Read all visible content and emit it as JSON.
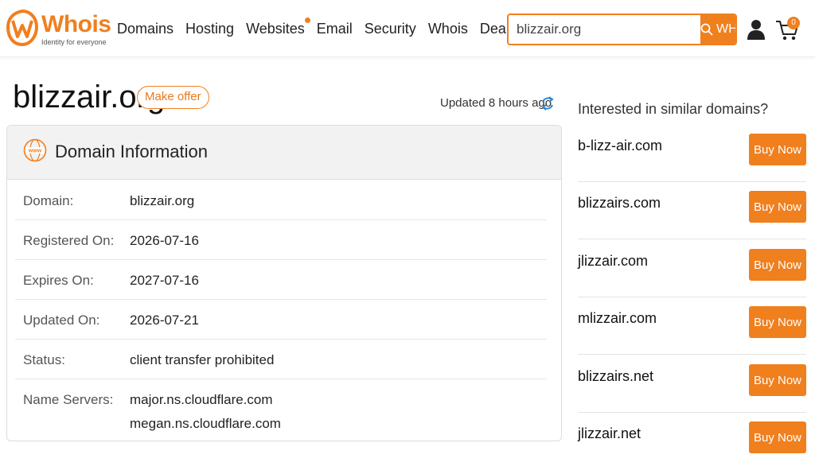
{
  "brand": {
    "name": "Whois",
    "tagline": "Identity for everyone",
    "accent_color": "#f07f1e"
  },
  "nav": {
    "items": [
      {
        "label": "Domains"
      },
      {
        "label": "Hosting"
      },
      {
        "label": "Websites",
        "has_dot": true
      },
      {
        "label": "Email"
      },
      {
        "label": "Security"
      },
      {
        "label": "Whois"
      },
      {
        "label": "Deals"
      }
    ]
  },
  "search": {
    "value": "blizzair.org",
    "button_label": "WHOIS"
  },
  "cart": {
    "count": "0"
  },
  "icons": {
    "logo": "whois-logo-icon",
    "search": "search-icon",
    "user": "user-icon",
    "cart": "cart-icon",
    "refresh": "refresh-icon",
    "www": "www-globe-icon"
  },
  "page": {
    "title": "blizzair.org",
    "make_offer_label": "Make offer",
    "updated_text": "Updated 8 hours ago"
  },
  "domain_info": {
    "title": "Domain Information",
    "rows": [
      {
        "label": "Domain:",
        "value": "blizzair.org"
      },
      {
        "label": "Registered On:",
        "value": "2026-07-16"
      },
      {
        "label": "Expires On:",
        "value": "2027-07-16"
      },
      {
        "label": "Updated On:",
        "value": "2026-07-21"
      },
      {
        "label": "Status:",
        "value": "client transfer prohibited"
      },
      {
        "label": "Name Servers:",
        "value": "major.ns.cloudflare.com",
        "value2": "megan.ns.cloudflare.com"
      }
    ]
  },
  "similar": {
    "title": "Interested in similar domains?",
    "buy_label": "Buy Now",
    "items": [
      {
        "name": "b-lizz-air.com"
      },
      {
        "name": "blizzairs.com"
      },
      {
        "name": "jlizzair.com"
      },
      {
        "name": "mlizzair.com"
      },
      {
        "name": "blizzairs.net"
      },
      {
        "name": "jlizzair.net"
      }
    ]
  }
}
